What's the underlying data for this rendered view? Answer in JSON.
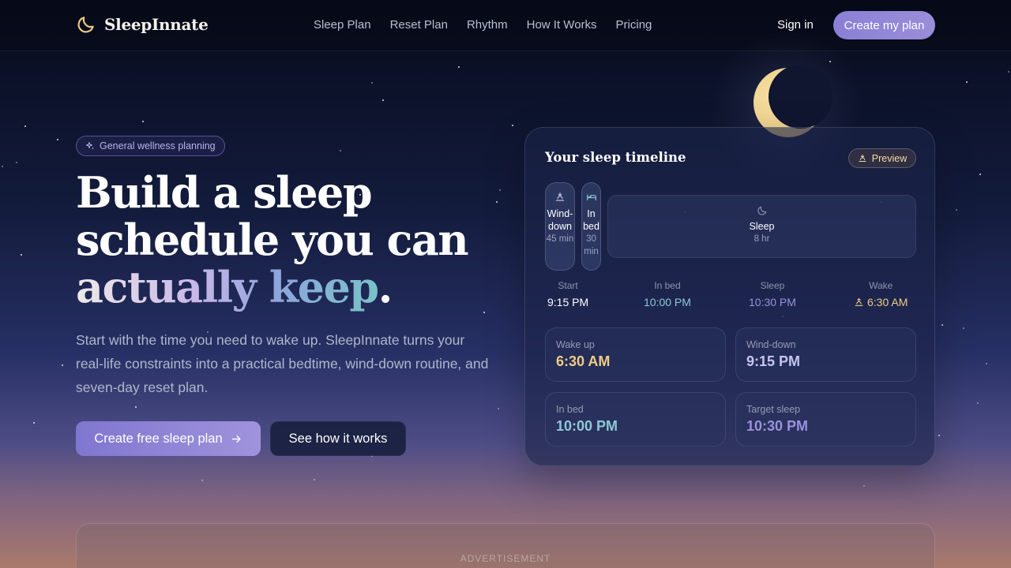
{
  "colors": {
    "accent": "#8b7fd6",
    "moon": "#e7c67e",
    "wake": "#f0cd86",
    "winddown": "#c4c6ee",
    "inbed": "#8fc9d8",
    "sleep": "#9a92dd"
  },
  "nav": {
    "brand": "SleepInnate",
    "brand_icon": "crescent-moon-icon",
    "links": [
      "Sleep Plan",
      "Reset Plan",
      "Rhythm",
      "How It Works",
      "Pricing"
    ],
    "signin": "Sign in",
    "cta": "Create my plan"
  },
  "hero": {
    "pill": "General wellness planning",
    "pill_icon": "sparkle-icon",
    "headline_line1": "Build a sleep",
    "headline_line2": "schedule you can",
    "headline_accent": "actually keep",
    "headline_period": ".",
    "subtext": "Start with the time you need to wake up. SleepInnate turns your real-life constraints into a practical bedtime, wind-down routine, and seven-day reset plan.",
    "primary_cta": "Create free sleep plan",
    "primary_icon": "arrow-right-icon",
    "secondary_cta": "See how it works"
  },
  "card": {
    "title": "Your sleep timeline",
    "preview": "Preview",
    "segments": {
      "winddown": {
        "label": "Wind-down",
        "duration": "45 min",
        "icon": "sunset-icon"
      },
      "inbed": {
        "label": "In bed",
        "duration": "30 min",
        "icon": "bed-icon"
      },
      "sleep": {
        "label": "Sleep",
        "duration": "8 hr",
        "icon": "moon-icon"
      }
    },
    "timeline": [
      {
        "caption": "Start",
        "value": "9:15 PM"
      },
      {
        "caption": "In bed",
        "value": "10:00 PM"
      },
      {
        "caption": "Sleep",
        "value": "10:30 PM"
      },
      {
        "caption": "Wake",
        "value": "6:30 AM",
        "icon": "sunrise-icon"
      }
    ],
    "stats": [
      {
        "caption": "Wake up",
        "value": "6:30 AM"
      },
      {
        "caption": "Wind-down",
        "value": "9:15 PM"
      },
      {
        "caption": "In bed",
        "value": "10:00 PM"
      },
      {
        "caption": "Target sleep",
        "value": "10:30 PM"
      }
    ]
  },
  "ad": {
    "label": "ADVERTISEMENT"
  }
}
